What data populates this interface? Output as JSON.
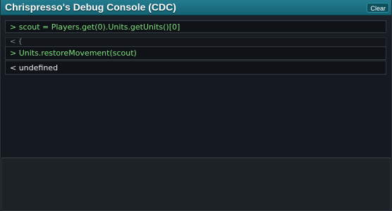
{
  "window": {
    "title": "Chrispresso's Debug Console (CDC)",
    "clear_label": "Clear"
  },
  "log": {
    "entries": [
      {
        "kind": "input",
        "text": "> scout = Players.get(0).Units.getUnits()[0]"
      },
      {
        "kind": "output-collapsed",
        "text": "< {"
      },
      {
        "kind": "input",
        "text": "> Units.restoreMovement(scout)"
      },
      {
        "kind": "output",
        "text": "< undefined"
      }
    ]
  },
  "command": {
    "value": ""
  },
  "colors": {
    "titlebar": "#1b7083",
    "input_text": "#7fe07d",
    "output_text": "#e8ecef",
    "panel_bg": "#161a1e"
  }
}
